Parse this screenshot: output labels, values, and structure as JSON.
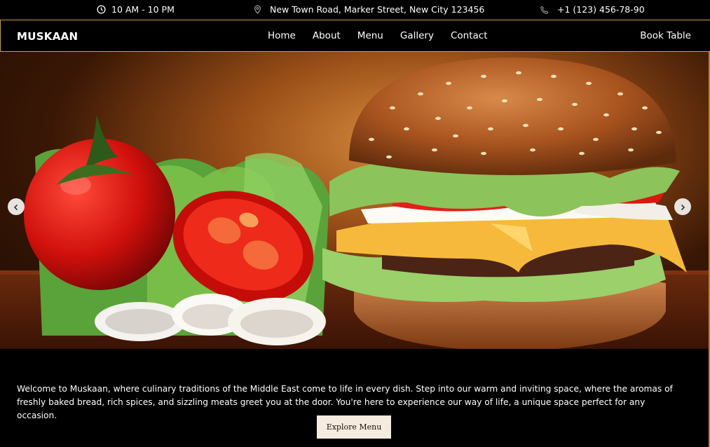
{
  "topbar": {
    "hours": "10 AM - 10 PM",
    "address": "New Town Road, Marker Street, New City 123456",
    "phone": "+1 (123) 456-78-90",
    "icons": [
      "clock-icon",
      "location-pin-icon",
      "phone-icon"
    ]
  },
  "nav": {
    "brand": "MUSKAAN",
    "items": [
      {
        "label": "Home"
      },
      {
        "label": "About"
      },
      {
        "label": "Menu"
      },
      {
        "label": "Gallery"
      },
      {
        "label": "Contact"
      }
    ],
    "cta": "Book Table"
  },
  "hero": {
    "prev_icon": "chevron-left-icon",
    "next_icon": "chevron-right-icon"
  },
  "intro": {
    "text": "Welcome to Muskaan, where culinary traditions of the Middle East come to life in every dish. Step into our warm and inviting space, where the aromas of freshly baked bread, rich spices, and sizzling meats greet you at the door. You're here to experience our way of life, a unique space perfect for any occasion.",
    "button": "Explore Menu"
  },
  "colors": {
    "accent_gold": "#c9a23c",
    "button_bg": "#f5ecdf"
  }
}
